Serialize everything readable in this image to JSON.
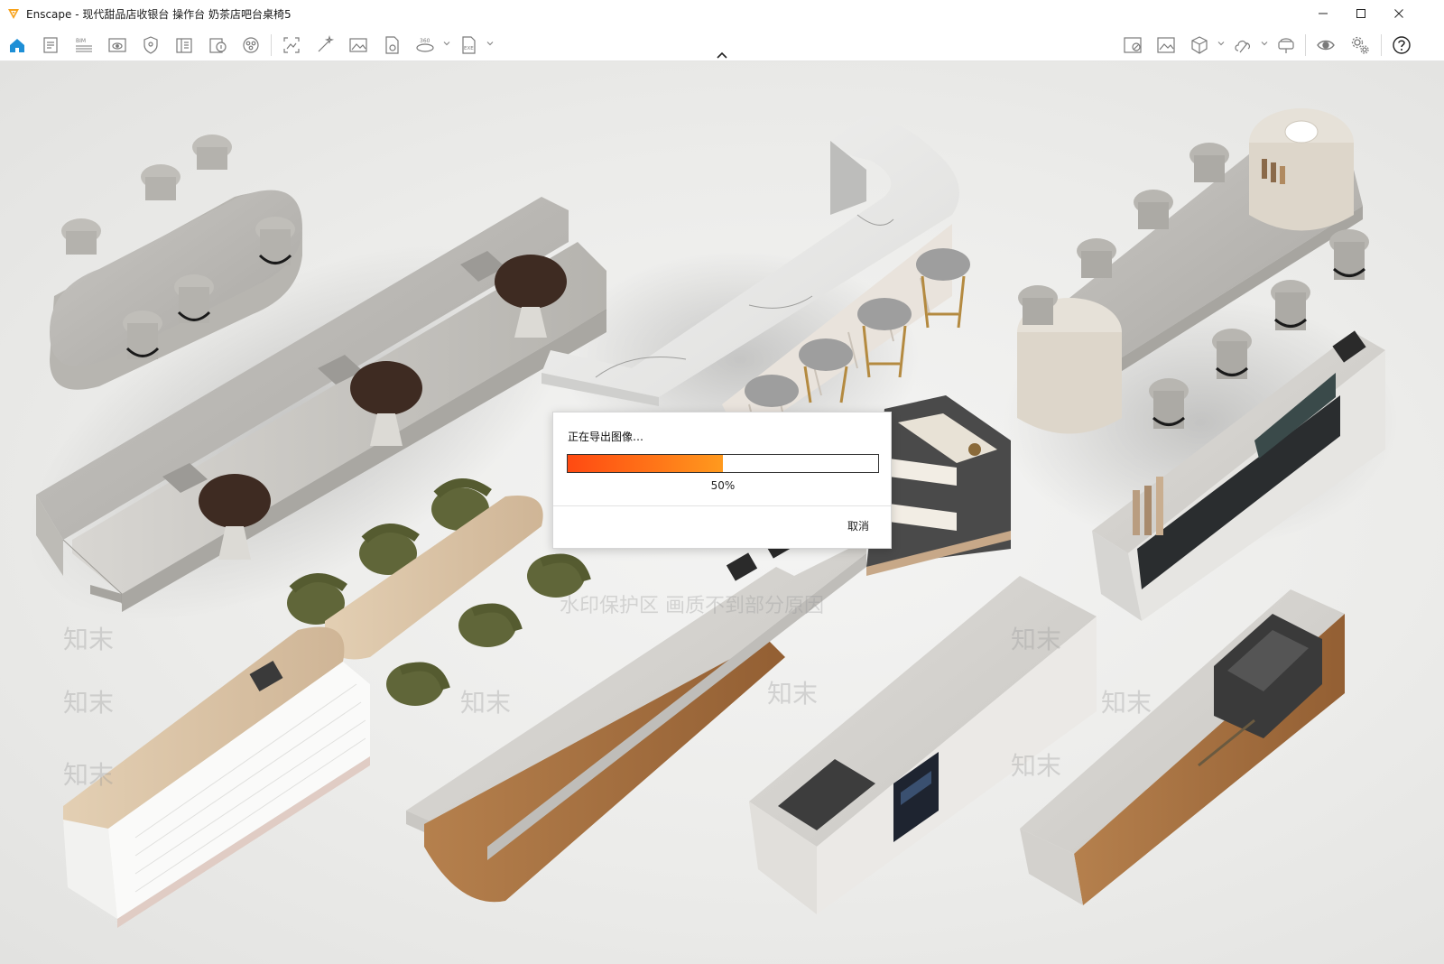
{
  "window": {
    "title": "Enscape - 现代甜品店收银台 操作台 奶茶店吧台桌椅5",
    "accent": "#f7a21b"
  },
  "toolbar": {
    "left_icons": [
      "home-icon",
      "document-icon",
      "bim-icon",
      "view-icon",
      "shield-icon",
      "book-icon",
      "info-icon",
      "asset-library-icon",
      "screenshot-icon",
      "magic-wand-icon",
      "image-icon",
      "batch-render-icon",
      "panorama-360-icon",
      "export-exe-icon"
    ],
    "right_icons": [
      "no-image-icon",
      "image-gallery-icon",
      "cube-icon",
      "cloud-icon",
      "vr-headset-icon",
      "eye-icon",
      "settings-icon",
      "help-icon"
    ],
    "bim_label": "BIM",
    "pano_label": "360",
    "exe_label": "EXE"
  },
  "dialog": {
    "message": "正在导出图像…",
    "progress": 0.5,
    "progress_text": "50%",
    "cancel_label": "取消",
    "progress_color": "#ff6a16"
  },
  "watermark": {
    "text_main": "水印保护区  画质不到部分原因",
    "text_brand": "知末"
  }
}
